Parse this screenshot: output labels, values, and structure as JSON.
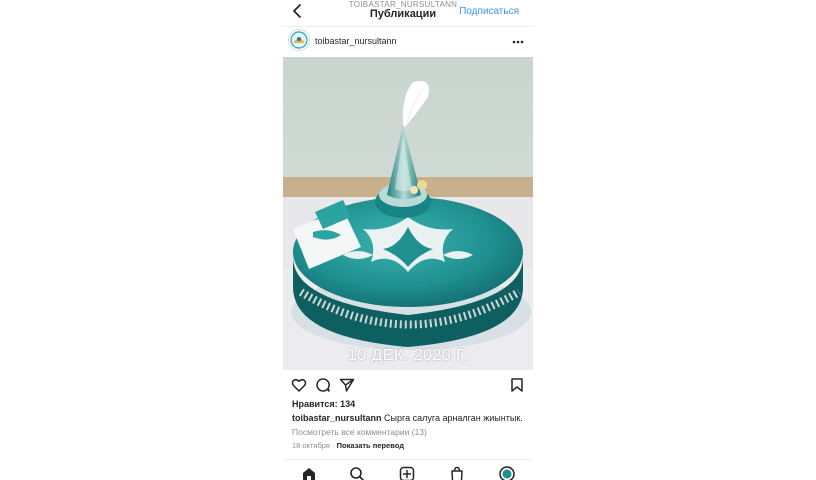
{
  "topbar": {
    "account_handle": "TOIBASTAR_NURSULTANN",
    "title": "Публикации",
    "follow_label": "Подписаться"
  },
  "post": {
    "username": "toibastar_nursultann",
    "photo_overlay_text": "10 ДЕК. 2020 Г.",
    "likes_text": "Нравится: 134",
    "caption_user": "toibastar_nursultann",
    "caption_text": "Сырга салуга арналган жиынтык.",
    "view_comments": "Посмотреть все комментарии (13)",
    "date": "18 октября",
    "separator": "·",
    "translate_label": "Показать перевод"
  },
  "icons": {
    "back": "chevron-left-icon",
    "more": "more-horizontal-icon",
    "like": "heart-icon",
    "comment": "comment-icon",
    "share": "send-icon",
    "save": "bookmark-icon",
    "home": "home-icon",
    "search": "search-icon",
    "new_post": "add-post-icon",
    "shop": "shop-icon",
    "profile": "profile-icon"
  },
  "colors": {
    "link_blue": "#3897f0",
    "text_primary": "#262626",
    "text_secondary": "#8e8e8e",
    "teal": "#1f8f8f"
  }
}
